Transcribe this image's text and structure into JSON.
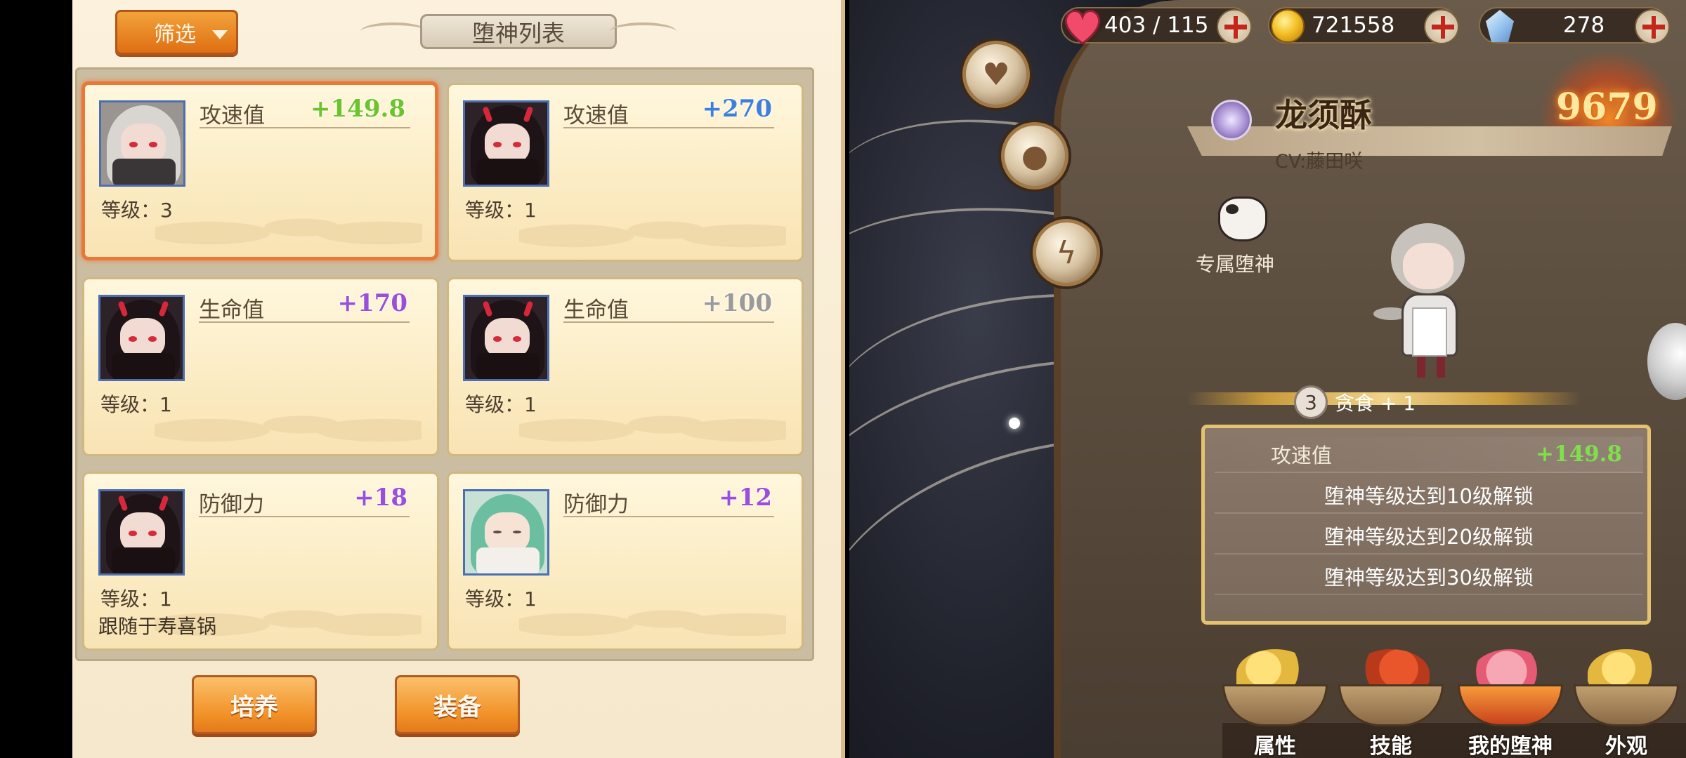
{
  "left_panel": {
    "filter_label": "筛选",
    "list_title": "堕神列表",
    "cards": [
      {
        "stat_name": "攻速值",
        "stat_value": "+149.8",
        "value_color": "#6cc32c",
        "level": "等级：3",
        "portrait": "maid-icon",
        "note": ""
      },
      {
        "stat_name": "攻速值",
        "stat_value": "+270",
        "value_color": "#3f7fdc",
        "level": "等级：1",
        "portrait": "demon-girl-icon",
        "note": ""
      },
      {
        "stat_name": "生命值",
        "stat_value": "+170",
        "value_color": "#9b4fd8",
        "level": "等级：1",
        "portrait": "demon-girl-icon",
        "note": ""
      },
      {
        "stat_name": "生命值",
        "stat_value": "+100",
        "value_color": "#9a9a9a",
        "level": "等级：1",
        "portrait": "demon-girl-icon",
        "note": ""
      },
      {
        "stat_name": "防御力",
        "stat_value": "+18",
        "value_color": "#9b4fd8",
        "level": "等级：1",
        "portrait": "demon-girl-icon",
        "note": "跟随于寿喜锅"
      },
      {
        "stat_name": "防御力",
        "stat_value": "+12",
        "value_color": "#9b4fd8",
        "level": "等级：1",
        "portrait": "green-hair-girl-icon",
        "note": ""
      }
    ],
    "train_label": "培养",
    "equip_label": "装备"
  },
  "topbar": {
    "stamina": "403 / 115",
    "gold": "721558",
    "crystals": "278"
  },
  "character": {
    "name": "龙须酥",
    "power": "9679",
    "cv": "CV:藤田咲",
    "exclusive_label": "专属堕神",
    "gluttony_level": "3",
    "gluttony_text": "贪食 + 1"
  },
  "attributes": {
    "first_name": "攻速值",
    "first_value": "+149.8",
    "locked": [
      "堕神等级达到10级解锁",
      "堕神等级达到20级解锁",
      "堕神等级达到30级解锁"
    ]
  },
  "bottom_tabs": [
    "属性",
    "技能",
    "我的堕神",
    "外观"
  ],
  "colors": {
    "accent_orange": "#e8773a",
    "green_value": "#7fe04c",
    "gold_border": "#e3c36f"
  }
}
